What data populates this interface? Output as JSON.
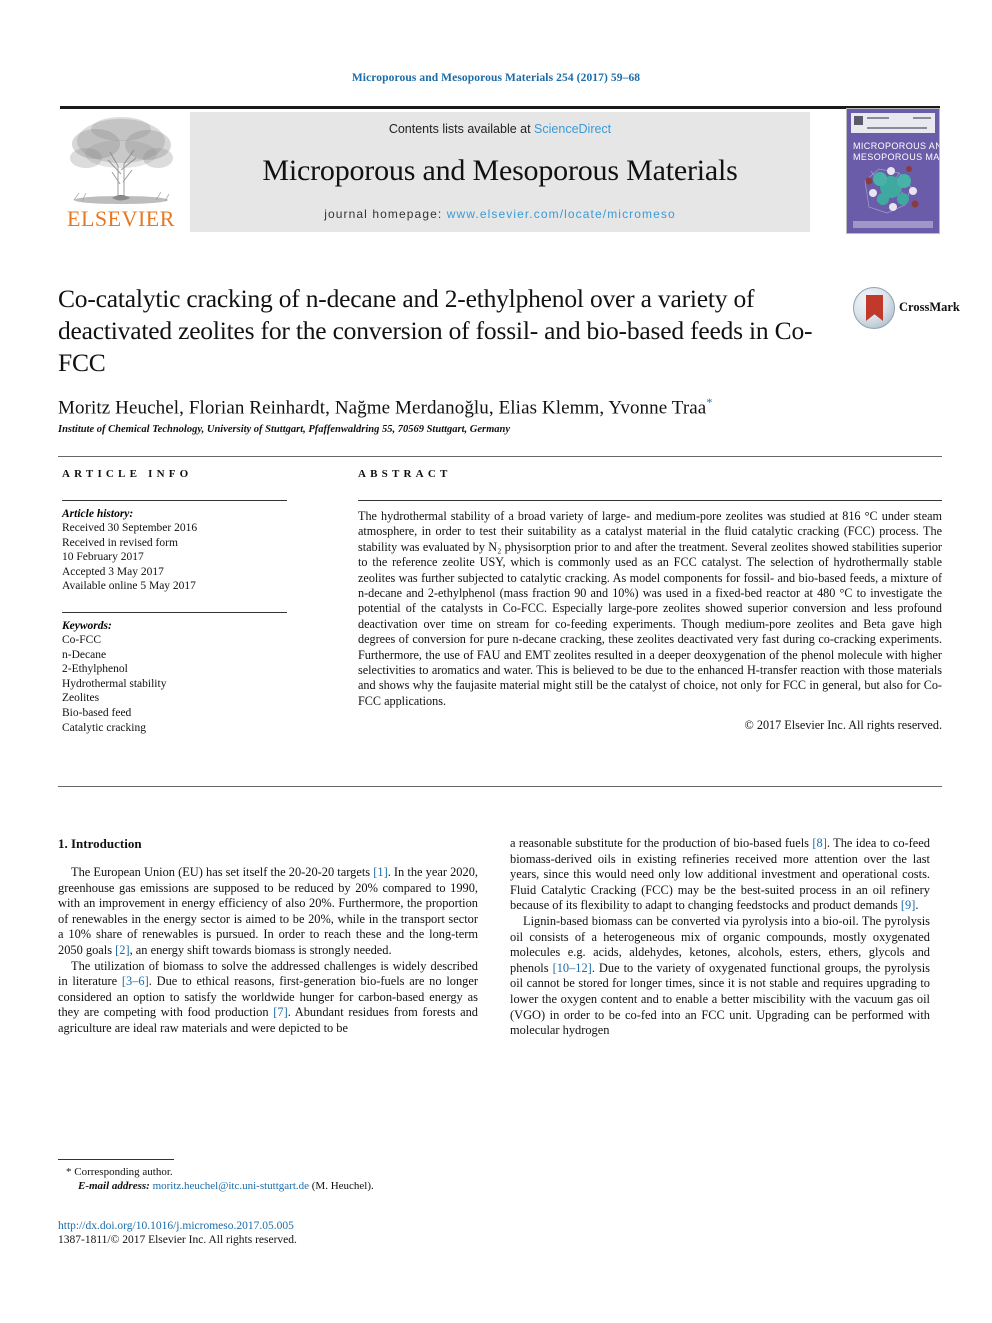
{
  "running_head": "Microporous and Mesoporous Materials 254 (2017) 59–68",
  "masthead": {
    "contents_prefix": "Contents lists available at ",
    "sciencedirect": "ScienceDirect",
    "journal_title": "Microporous and Mesoporous Materials",
    "homepage_prefix": "journal homepage: ",
    "homepage_url": "www.elsevier.com/locate/micromeso",
    "publisher_name": "ELSEVIER",
    "cover": {
      "line1": "MICROPOROUS AND",
      "line2": "MESOPOROUS MATERIALS",
      "bg_color": "#6a5ca8"
    },
    "accent_link_color": "#3a9bd5"
  },
  "article": {
    "title": "Co-catalytic cracking of n-decane and 2-ethylphenol over a variety of deactivated zeolites for the conversion of fossil- and bio-based feeds in Co-FCC",
    "authors": "Moritz Heuchel, Florian Reinhardt, Nağme Merdanoğlu, Elias Klemm, Yvonne Traa",
    "author_star": "*",
    "affiliation": "Institute of Chemical Technology, University of Stuttgart, Pfaffenwaldring 55, 70569 Stuttgart, Germany",
    "crossmark_label": "CrossMark"
  },
  "info": {
    "header": "ARTICLE INFO",
    "history_label": "Article history:",
    "history_lines": [
      "Received 30 September 2016",
      "Received in revised form",
      "10 February 2017",
      "Accepted 3 May 2017",
      "Available online 5 May 2017"
    ],
    "keywords_label": "Keywords:",
    "keywords": [
      "Co-FCC",
      "n-Decane",
      "2-Ethylphenol",
      "Hydrothermal stability",
      "Zeolites",
      "Bio-based feed",
      "Catalytic cracking"
    ]
  },
  "abstract": {
    "header": "ABSTRACT",
    "text": "The hydrothermal stability of a broad variety of large- and medium-pore zeolites was studied at 816 °C under steam atmosphere, in order to test their suitability as a catalyst material in the fluid catalytic cracking (FCC) process. The stability was evaluated by N₂ physisorption prior to and after the treatment. Several zeolites showed stabilities superior to the reference zeolite USY, which is commonly used as an FCC catalyst. The selection of hydrothermally stable zeolites was further subjected to catalytic cracking. As model components for fossil- and bio-based feeds, a mixture of n-decane and 2-ethylphenol (mass fraction 90 and 10%) was used in a fixed-bed reactor at 480 °C to investigate the potential of the catalysts in Co-FCC. Especially large-pore zeolites showed superior conversion and less profound deactivation over time on stream for co-feeding experiments. Though medium-pore zeolites and Beta gave high degrees of conversion for pure n-decane cracking, these zeolites deactivated very fast during co-cracking experiments. Furthermore, the use of FAU and EMT zeolites resulted in a deeper deoxygenation of the phenol molecule with higher selectivities to aromatics and water. This is believed to be due to the enhanced H-transfer reaction with those materials and shows why the faujasite material might still be the catalyst of choice, not only for FCC in general, but also for Co-FCC applications.",
    "copyright": "© 2017 Elsevier Inc. All rights reserved."
  },
  "introduction": {
    "heading": "1. Introduction",
    "left_paragraphs": [
      "The European Union (EU) has set itself the 20-20-20 targets [1]. In the year 2020, greenhouse gas emissions are supposed to be reduced by 20% compared to 1990, with an improvement in energy efficiency of also 20%. Furthermore, the proportion of renewables in the energy sector is aimed to be 20%, while in the transport sector a 10% share of renewables is pursued. In order to reach these and the long-term 2050 goals [2], an energy shift towards biomass is strongly needed.",
      "The utilization of biomass to solve the addressed challenges is widely described in literature [3–6]. Due to ethical reasons, first-generation bio-fuels are no longer considered an option to satisfy the worldwide hunger for carbon-based energy as they are competing with food production [7]. Abundant residues from forests and agriculture are ideal raw materials and were depicted to be"
    ],
    "right_paragraphs": [
      "a reasonable substitute for the production of bio-based fuels [8]. The idea to co-feed biomass-derived oils in existing refineries received more attention over the last years, since this would need only low additional investment and operational costs. Fluid Catalytic Cracking (FCC) may be the best-suited process in an oil refinery because of its flexibility to adapt to changing feedstocks and product demands [9].",
      "Lignin-based biomass can be converted via pyrolysis into a bio-oil. The pyrolysis oil consists of a heterogeneous mix of organic compounds, mostly oxygenated molecules e.g. acids, aldehydes, ketones, alcohols, esters, ethers, glycols and phenols [10–12]. Due to the variety of oxygenated functional groups, the pyrolysis oil cannot be stored for longer times, since it is not stable and requires upgrading to lower the oxygen content and to enable a better miscibility with the vacuum gas oil (VGO) in order to be co-fed into an FCC unit. Upgrading can be performed with molecular hydrogen"
    ]
  },
  "footer": {
    "corresponding_star": "*",
    "corresponding_label": "Corresponding author.",
    "email_label": "E-mail address:",
    "email": "moritz.heuchel@itc.uni-stuttgart.de",
    "email_owner": "(M. Heuchel).",
    "doi_url": "http://dx.doi.org/10.1016/j.micromeso.2017.05.005",
    "issn_line": "1387-1811/© 2017 Elsevier Inc. All rights reserved.",
    "link_color": "#1b6ca8"
  }
}
